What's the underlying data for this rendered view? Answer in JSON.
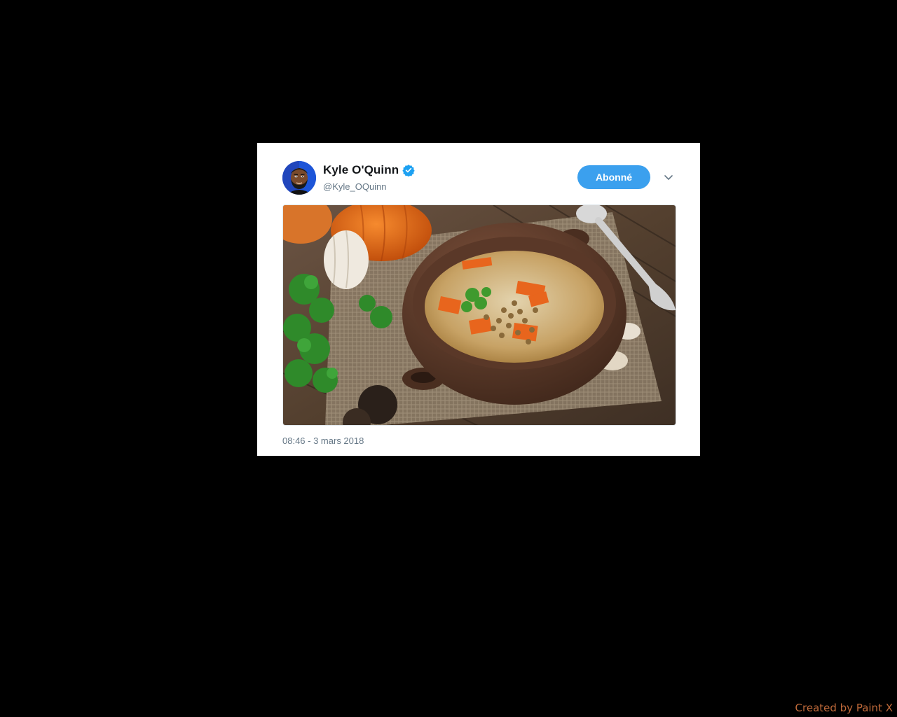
{
  "tweet": {
    "display_name": "Kyle O'Quinn",
    "handle": "@Kyle_OQuinn",
    "verified": true,
    "follow_button_label": "Abonné",
    "timestamp": "08:46 - 3 mars 2018",
    "media_description_icon": "photo-soup-bowl",
    "avatar_icon": "cartoon-avatar"
  },
  "colors": {
    "accent": "#3ba0ee",
    "verified": "#1da1f2",
    "name": "#14171a",
    "secondary_text": "#657786",
    "background": "#000000",
    "watermark": "#c06a3a"
  },
  "watermark": {
    "text": "Created by Paint X"
  }
}
